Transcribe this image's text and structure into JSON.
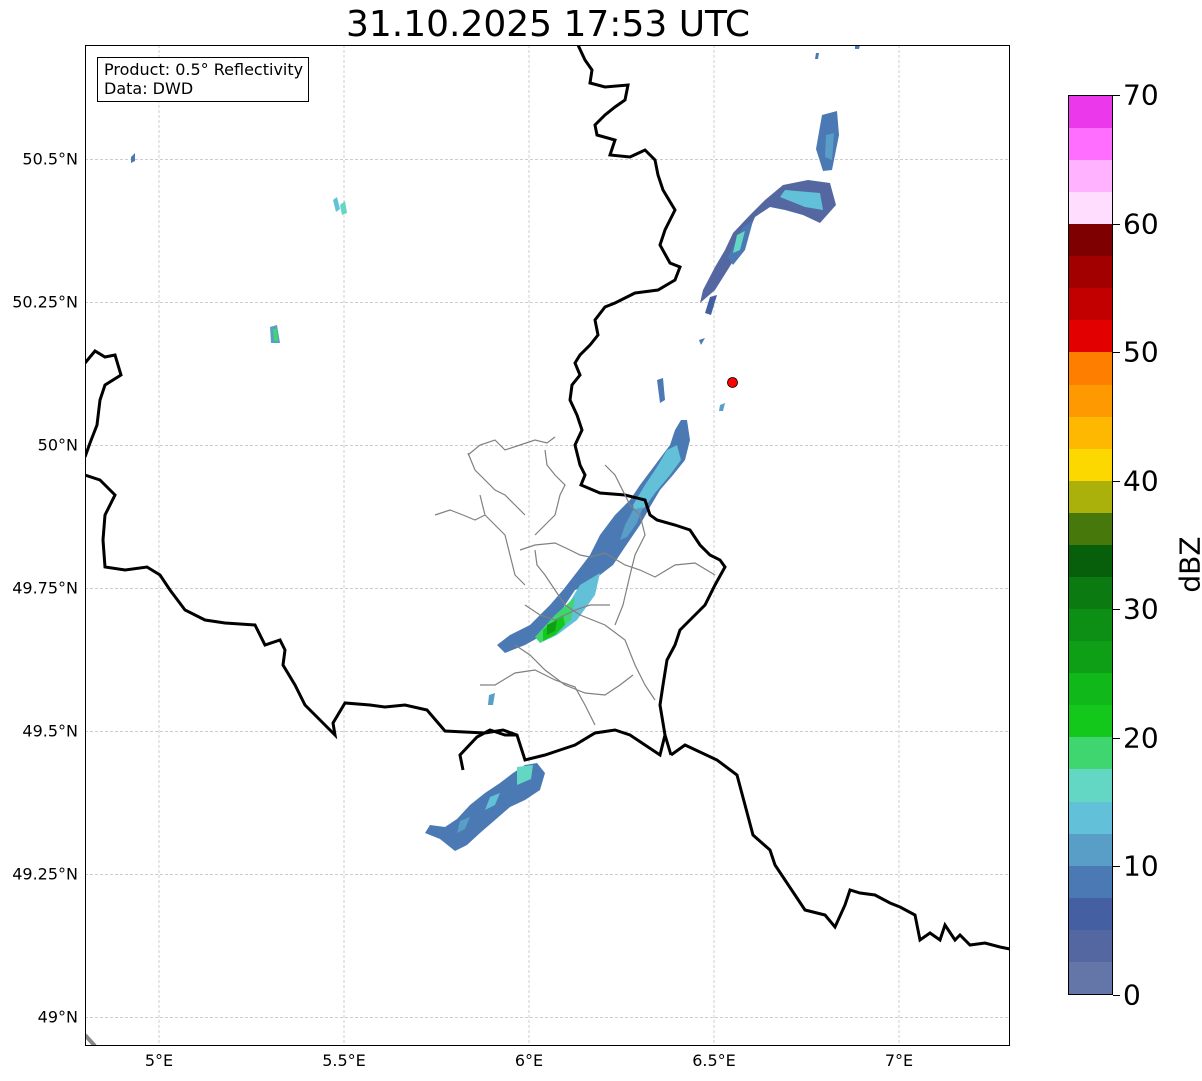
{
  "title": "31.10.2025 17:53 UTC",
  "info_box": {
    "product": "Product: 0.5° Reflectivity",
    "data": "Data: DWD"
  },
  "colorbar": {
    "unit": "dBZ",
    "min": 0,
    "max": 70,
    "tick_values": [
      0,
      10,
      20,
      30,
      40,
      50,
      60,
      70
    ],
    "tick_labels": [
      "0",
      "10",
      "20",
      "30",
      "40",
      "50",
      "60",
      "70"
    ],
    "colors": [
      "#6476a8",
      "#5467a0",
      "#4560a2",
      "#4b79b3",
      "#589ec6",
      "#62c1d9",
      "#64d6c4",
      "#3fd670",
      "#13c71b",
      "#10b81a",
      "#0f9f17",
      "#0c8f14",
      "#0b7a10",
      "#075f0b",
      "#47780b",
      "#aab10a",
      "#fdd800",
      "#feb802",
      "#fe9902",
      "#fe7f00",
      "#e30000",
      "#c20000",
      "#a20000",
      "#7e0000",
      "#ffddff",
      "#ffb2ff",
      "#ff6eff",
      "#ea38ea"
    ]
  },
  "map": {
    "lat_labels": [
      "50.5°N",
      "50.25°N",
      "50°N",
      "49.75°N",
      "49.5°N",
      "49.25°N",
      "49°N"
    ],
    "lon_labels": [
      "5°E",
      "5.5°E",
      "6°E",
      "6.5°E",
      "7°E"
    ],
    "extent": {
      "lon_min": 4.8,
      "lon_max": 7.3,
      "lat_min": 48.95,
      "lat_max": 50.7
    },
    "radar_site": {
      "lon": 6.55,
      "lat": 50.11,
      "color": "#ff0000"
    },
    "echoes": [
      {
        "lon": 6.8,
        "lat": 50.5,
        "dbz": 8
      },
      {
        "lon": 6.75,
        "lat": 50.43,
        "dbz": 14
      },
      {
        "lon": 6.68,
        "lat": 50.38,
        "dbz": 10
      },
      {
        "lon": 6.6,
        "lat": 50.33,
        "dbz": 12
      },
      {
        "lon": 6.55,
        "lat": 50.27,
        "dbz": 8
      },
      {
        "lon": 6.38,
        "lat": 50.05,
        "dbz": 10
      },
      {
        "lon": 6.3,
        "lat": 49.93,
        "dbz": 16
      },
      {
        "lon": 6.24,
        "lat": 49.85,
        "dbz": 12
      },
      {
        "lon": 6.14,
        "lat": 49.75,
        "dbz": 18
      },
      {
        "lon": 6.07,
        "lat": 49.67,
        "dbz": 28
      },
      {
        "lon": 5.98,
        "lat": 49.65,
        "dbz": 10
      },
      {
        "lon": 5.95,
        "lat": 49.4,
        "dbz": 12
      },
      {
        "lon": 5.85,
        "lat": 49.35,
        "dbz": 10
      },
      {
        "lon": 5.31,
        "lat": 50.2,
        "dbz": 14
      },
      {
        "lon": 5.48,
        "lat": 50.42,
        "dbz": 16
      },
      {
        "lon": 4.93,
        "lat": 50.51,
        "dbz": 8
      }
    ]
  }
}
